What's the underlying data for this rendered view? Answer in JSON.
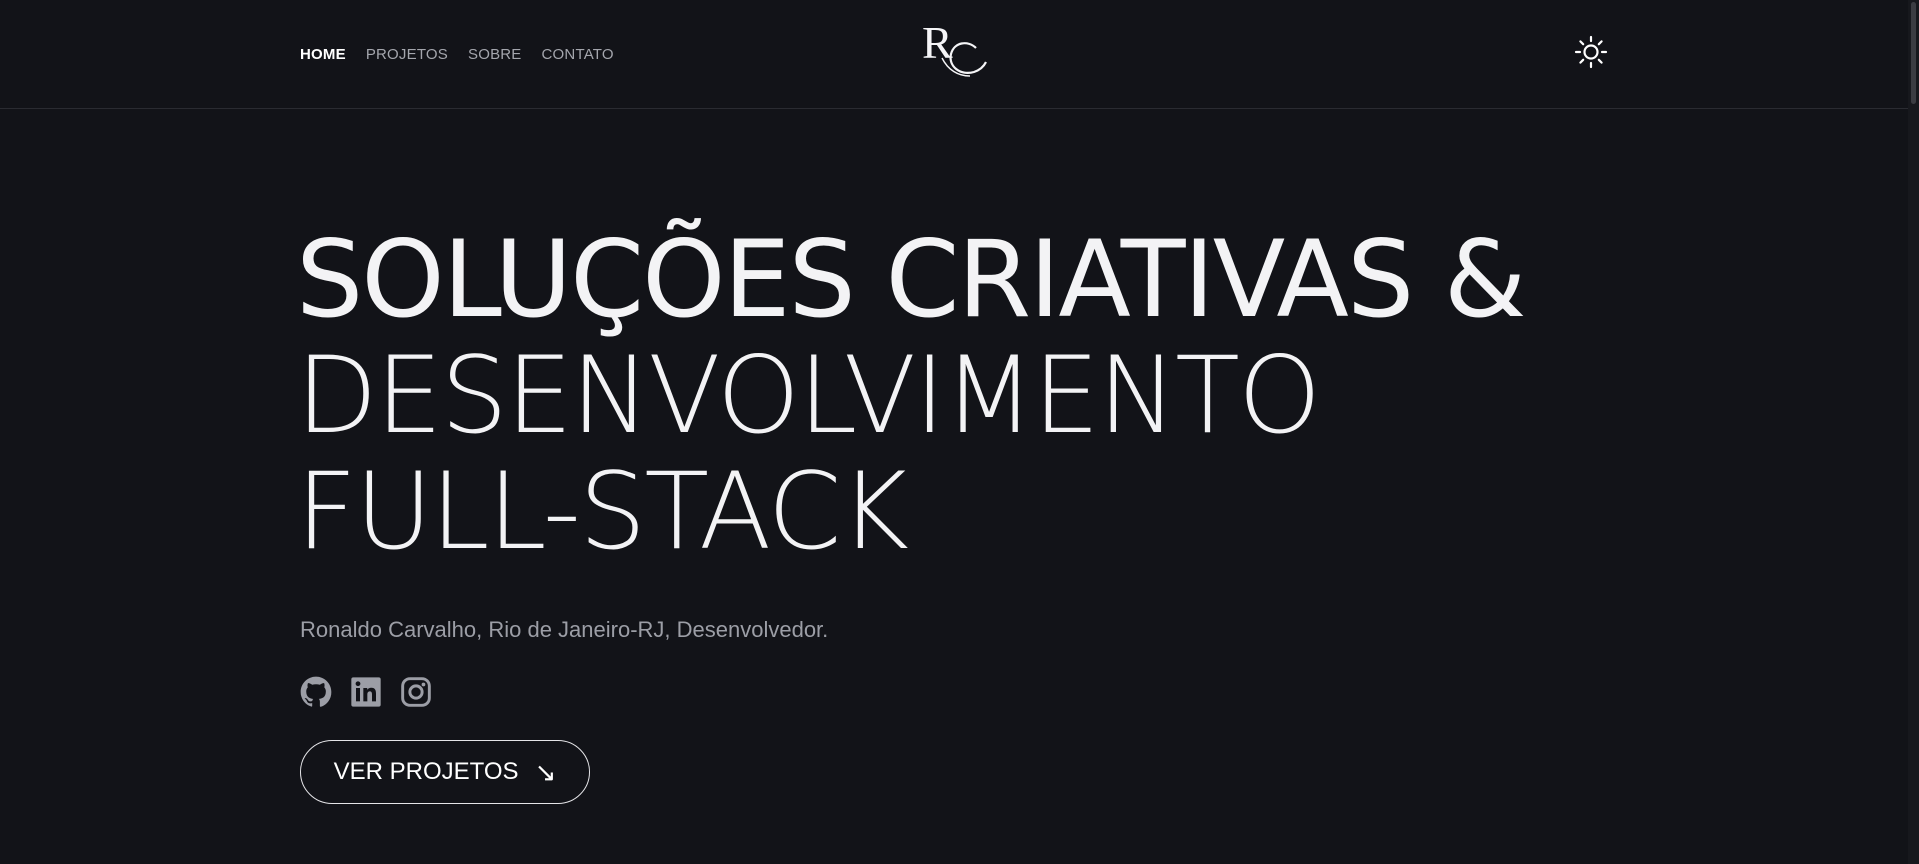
{
  "nav": {
    "items": [
      {
        "label": "HOME",
        "active": true
      },
      {
        "label": "PROJETOS",
        "active": false
      },
      {
        "label": "SOBRE",
        "active": false
      },
      {
        "label": "CONTATO",
        "active": false
      }
    ]
  },
  "logo": {
    "monogram": "RC"
  },
  "theme_toggle": {
    "icon": "sun-icon"
  },
  "hero": {
    "line1": "SOLUÇÕES CRIATIVAS &",
    "line2": "DESENVOLVIMENTO",
    "line3": "FULL-STACK",
    "subtitle": "Ronaldo Carvalho, Rio de Janeiro-RJ, Desenvolvedor."
  },
  "socials": [
    {
      "icon": "github-icon"
    },
    {
      "icon": "linkedin-icon"
    },
    {
      "icon": "instagram-icon"
    }
  ],
  "cta": {
    "label": "VER PROJETOS",
    "arrow": "↘"
  },
  "colors": {
    "background": "#121318",
    "text": "#f3f3f5",
    "muted": "#9c9ea6"
  }
}
